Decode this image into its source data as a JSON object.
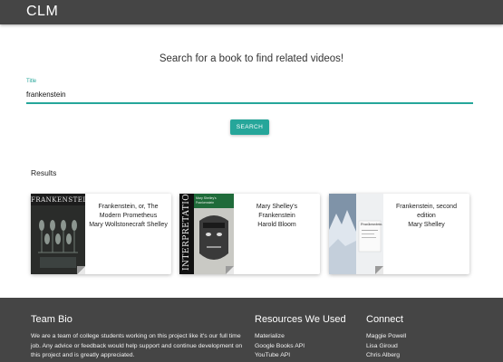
{
  "navbar": {
    "brand": "CLM"
  },
  "search": {
    "headline": "Search for a book to find related videos!",
    "label": "Title",
    "value": "frankenstein",
    "button": "SEARCH"
  },
  "results": {
    "heading": "Results",
    "books": [
      {
        "title": "Frankenstein, or, The Modern Prometheus",
        "author": "Mary Wollstonecraft Shelley",
        "cover_text": "FRANKENSTEIN"
      },
      {
        "title": "Mary Shelley's Frankenstein",
        "author": "Harold Bloom",
        "cover_text": "INTERPRETATIONS",
        "cover_small_text": "Mary Shelley's Frankenstein"
      },
      {
        "title": "Frankenstein, second edition",
        "author": "Mary Shelley",
        "cover_text": "Frankenstein"
      }
    ]
  },
  "footer": {
    "bio_title": "Team Bio",
    "bio_text": "We are a team of college students working on this project like it's our full time job. Any advice or feedback would help support and continue development on this project and is greatly appreciated.",
    "resources_title": "Resources We Used",
    "resources": [
      "Materialize",
      "Google Books API",
      "YouTube API"
    ],
    "connect_title": "Connect",
    "connect": [
      "Maggie Powell",
      "Lisa Giroud",
      "Chris Alberg"
    ]
  },
  "colors": {
    "nav": "#454545",
    "accent": "#26a69a",
    "footer": "#454545"
  }
}
